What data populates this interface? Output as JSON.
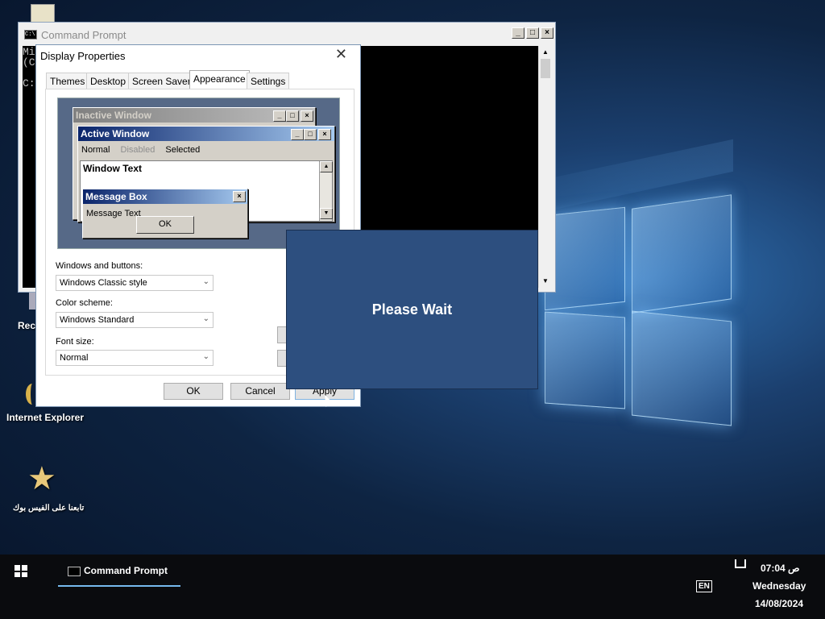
{
  "desktop": {
    "icons": [
      {
        "label": "Rec",
        "icon": "recycle-bin-icon"
      },
      {
        "label": "Internet Explorer",
        "icon": "internet-explorer-icon"
      },
      {
        "label": "تابعنا على الفيس بوك",
        "icon": "star-icon"
      }
    ]
  },
  "cmd_window": {
    "title": "Command Prompt",
    "lines": [
      "Mi",
      "(C",
      "",
      "C:"
    ],
    "buttons": [
      "_",
      "□",
      "×"
    ]
  },
  "display_properties": {
    "title": "Display Properties",
    "close_glyph": "✕",
    "tabs": [
      "Themes",
      "Desktop",
      "Screen Saver",
      "Appearance",
      "Settings"
    ],
    "active_tab": "Appearance",
    "preview": {
      "inactive_title": "Inactive Window",
      "active_title": "Active Window",
      "menu": [
        "Normal",
        "Disabled",
        "Selected"
      ],
      "window_text": "Window Text",
      "message_box_title": "Message Box",
      "message_text": "Message Text",
      "ok_label": "OK"
    },
    "windows_buttons_label": "Windows and buttons:",
    "windows_buttons_value": "Windows Classic style",
    "color_scheme_label": "Color scheme:",
    "color_scheme_value": "Windows Standard",
    "font_size_label": "Font size:",
    "font_size_value": "Normal",
    "ok": "OK",
    "cancel": "Cancel",
    "apply": "Apply"
  },
  "please_wait": "Please Wait",
  "taskbar": {
    "app": "Command Prompt",
    "time": "07:04",
    "ampm": "ص",
    "day": "Wednesday",
    "date": "14/08/2024",
    "lang": "EN"
  },
  "colors": {
    "active_title_start": "#0a246a",
    "wait_bg": "#2d4f7f",
    "taskbar_accent": "#76b9ed"
  }
}
